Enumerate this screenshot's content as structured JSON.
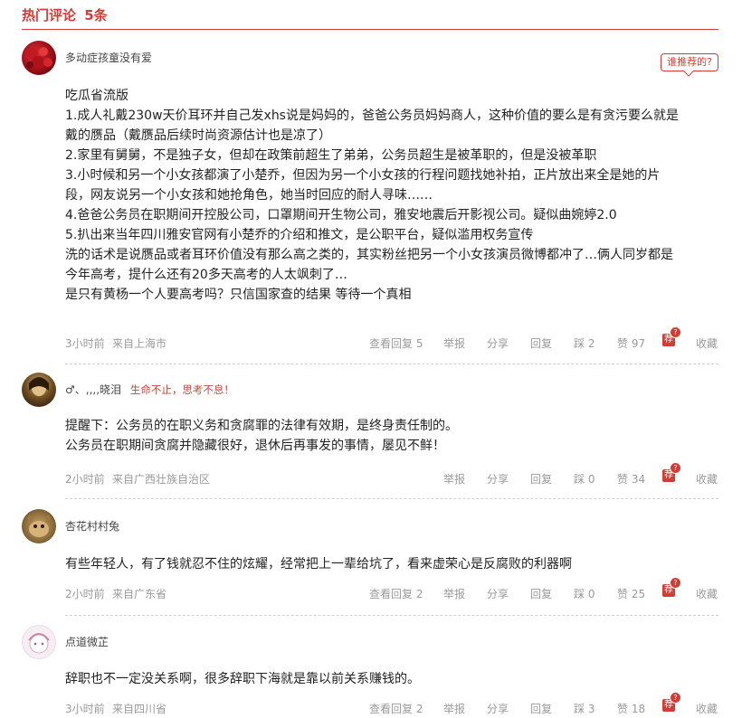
{
  "header": {
    "title": "热门评论",
    "count": "5条"
  },
  "comments": [
    {
      "username": "多动症孩童没有爱",
      "signature": "",
      "recommend_label": "谁推荐的?",
      "lines": [
        "吃瓜省流版",
        "1.成人礼戴230w天价耳环并自己发xhs说是妈妈的，爸爸公务员妈妈商人，这种价值的要么是有贪污要么就是",
        "戴的赝品（戴赝品后续时尚资源估计也是凉了）",
        "2.家里有舅舅，不是独子女，但却在政策前超生了弟弟，公务员超生是被革职的，但是没被革职",
        "3.小时候和另一个小女孩都演了小楚乔，但因为另一个小女孩的行程问题找她补拍，正片放出来全是她的片",
        "段，网友说另一个小女孩和她抢角色，她当时回应的耐人寻味……",
        "4.爸爸公务员在职期间开控股公司，口罩期间开生物公司，雅安地震后开影视公司。疑似曲婉婷2.0",
        "5.扒出来当年四川雅安官网有小楚乔的介绍和推文，是公职平台，疑似滥用权务宣传",
        "洗的话术是说赝品或者耳环价值没有那么高之类的，其实粉丝把另一个小女孩演员微博都冲了…俩人同岁都是",
        "今年高考，提什么还有20多天高考的人太飒刺了…",
        "是只有黄杨一个人要高考吗？只信国家查的结果 等待一个真相"
      ],
      "time": "3小时前",
      "location": "来自上海市",
      "view_replies": "查看回复 5",
      "report": "举报",
      "share": "分享",
      "reply": "回复",
      "dislike": "踩 2",
      "like": "赞 97",
      "rec_badge": "荐",
      "collect": "收藏"
    },
    {
      "username": "♂、,,,,晓泪",
      "signature": "生命不止，思考不息！",
      "lines": [
        "提醒下：公务员的在职义务和贪腐罪的法律有效期，是终身责任制的。",
        "公务员在职期间贪腐并隐藏很好，退休后再事发的事情，屡见不鲜！"
      ],
      "time": "2小时前",
      "location": "来自广西壮族自治区",
      "view_replies": "",
      "report": "举报",
      "share": "分享",
      "reply": "回复",
      "dislike": "踩 0",
      "like": "赞 34",
      "rec_badge": "荐",
      "collect": "收藏"
    },
    {
      "username": "杏花村村兔",
      "signature": "",
      "lines": [
        "有些年轻人，有了钱就忍不住的炫耀，经常把上一辈给坑了，看来虚荣心是反腐败的利器啊"
      ],
      "time": "2小时前",
      "location": "来自广东省",
      "view_replies": "查看回复 2",
      "report": "举报",
      "share": "分享",
      "reply": "回复",
      "dislike": "踩 0",
      "like": "赞 25",
      "rec_badge": "荐",
      "collect": "收藏"
    },
    {
      "username": "点道微芷",
      "signature": "",
      "lines": [
        "辞职也不一定没关系啊，很多辞职下海就是靠以前关系赚钱的。"
      ],
      "time": "3小时前",
      "location": "来自四川省",
      "view_replies": "查看回复 2",
      "report": "举报",
      "share": "分享",
      "reply": "回复",
      "dislike": "踩 3",
      "like": "赞 18",
      "rec_badge": "荐",
      "collect": "收藏"
    }
  ]
}
